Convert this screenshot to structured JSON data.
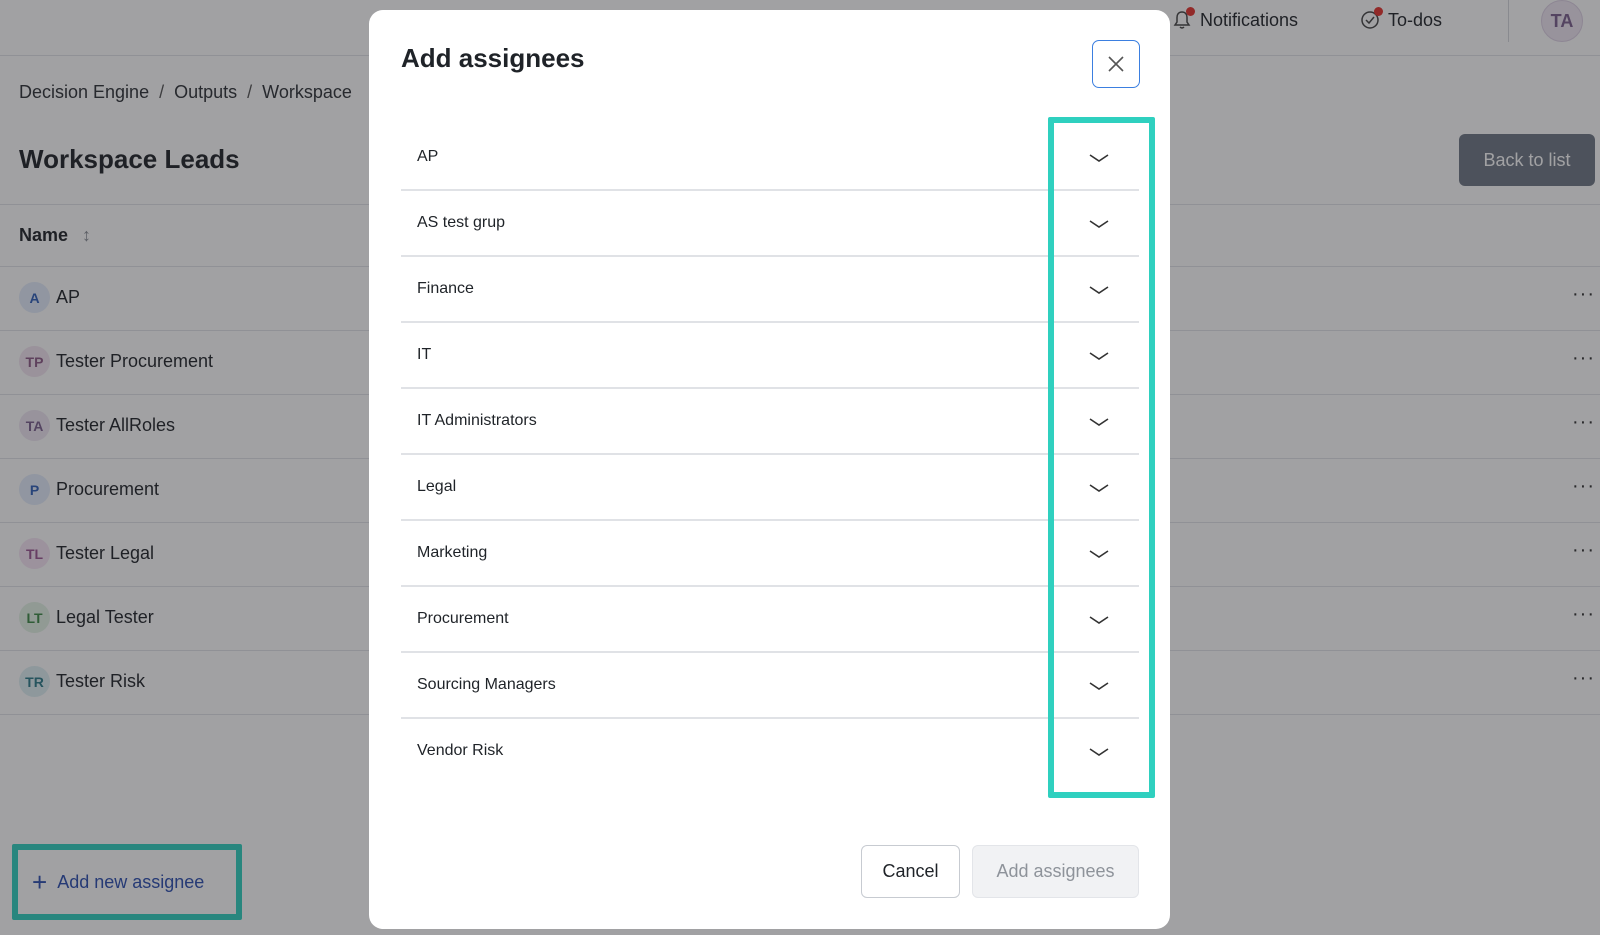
{
  "topbar": {
    "notifications_label": "Notifications",
    "todos_label": "To-dos",
    "user_initials": "TA"
  },
  "breadcrumb": [
    "Decision Engine",
    "Outputs",
    "Workspace"
  ],
  "page": {
    "title": "Workspace Leads",
    "back_label": "Back to list"
  },
  "table": {
    "name_header": "Name",
    "rows": [
      {
        "initials": "A",
        "name": "AP",
        "avatar_bg": "#e3ecfb",
        "avatar_fg": "#2f5fb8"
      },
      {
        "initials": "TP",
        "name": "Tester Procurement",
        "avatar_bg": "#f3e6f1",
        "avatar_fg": "#8d5a87"
      },
      {
        "initials": "TA",
        "name": "Tester AllRoles",
        "avatar_bg": "#efe7f3",
        "avatar_fg": "#7a5f8d"
      },
      {
        "initials": "P",
        "name": "Procurement",
        "avatar_bg": "#e3ecfb",
        "avatar_fg": "#2f5fb8"
      },
      {
        "initials": "TL",
        "name": "Tester Legal",
        "avatar_bg": "#f6e6f4",
        "avatar_fg": "#9b5593"
      },
      {
        "initials": "LT",
        "name": "Legal Tester",
        "avatar_bg": "#e4f3e5",
        "avatar_fg": "#3d8a45"
      },
      {
        "initials": "TR",
        "name": "Tester Risk",
        "avatar_bg": "#dff0f3",
        "avatar_fg": "#2b7b88"
      }
    ],
    "more_label": "···"
  },
  "add_new_assignee_label": "Add new assignee",
  "modal": {
    "title": "Add assignees",
    "groups": [
      "AP",
      "AS test grup",
      "Finance",
      "IT",
      "IT Administrators",
      "Legal",
      "Marketing",
      "Procurement",
      "Sourcing Managers",
      "Vendor Risk"
    ],
    "cancel_label": "Cancel",
    "submit_label": "Add assignees"
  },
  "colors": {
    "highlight": "#2fd0bf",
    "link": "#2b4eb0",
    "notification_dot": "#e5322d"
  }
}
